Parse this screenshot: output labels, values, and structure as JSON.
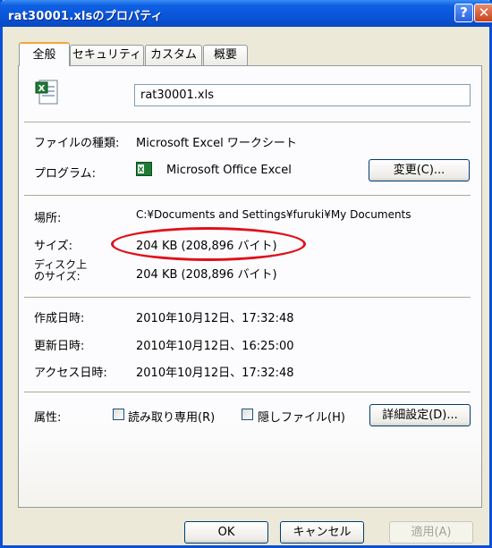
{
  "window": {
    "title": "rat30001.xlsのプロパティ",
    "help_label": "?",
    "close_label": "✕"
  },
  "tabs": [
    {
      "label": "全般",
      "active": true
    },
    {
      "label": "セキュリティ"
    },
    {
      "label": "カスタム"
    },
    {
      "label": "概要"
    }
  ],
  "general": {
    "file_name": "rat30001.xls",
    "file_icon": "excel-file-icon",
    "type_label": "ファイルの種類:",
    "type_value": "Microsoft Excel ワークシート",
    "program_label": "プログラム:",
    "program_value": "Microsoft Office Excel",
    "program_icon": "excel-app-icon",
    "change_button": "変更(C)...",
    "location_label": "場所:",
    "location_value": "C:¥Documents and Settings¥furuki¥My Documents",
    "size_label": "サイズ:",
    "size_value": "204 KB (208,896 バイト)",
    "disk_size_label_1": "ディスク上",
    "disk_size_label_2": "のサイズ:",
    "disk_size_value": "204 KB (208,896 バイト)",
    "created_label": "作成日時:",
    "created_value": "2010年10月12日、17:32:48",
    "modified_label": "更新日時:",
    "modified_value": "2010年10月12日、16:25:00",
    "accessed_label": "アクセス日時:",
    "accessed_value": "2010年10月12日、17:32:48",
    "attributes_label": "属性:",
    "readonly_label": "読み取り専用(R)",
    "readonly_checked": false,
    "hidden_label": "隠しファイル(H)",
    "hidden_checked": false,
    "advanced_button": "詳細設定(D)..."
  },
  "footer": {
    "ok": "OK",
    "cancel": "キャンセル",
    "apply": "適用(A)"
  },
  "colors": {
    "title_bar": "#0a55d9",
    "highlight_circle": "#e0101a",
    "tab_accent": "#f1a73a"
  }
}
